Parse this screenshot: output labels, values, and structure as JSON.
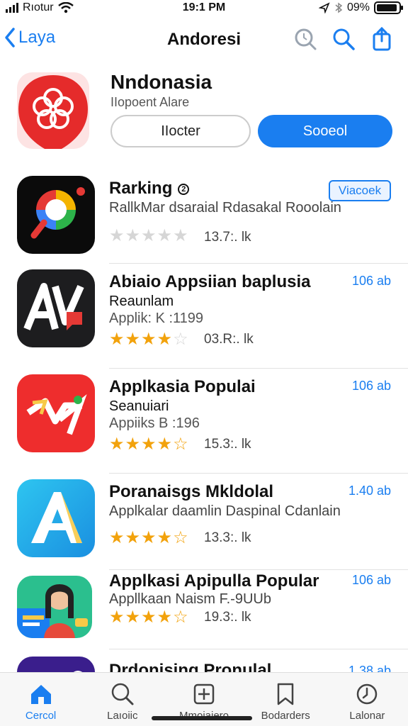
{
  "status_bar": {
    "carrier": "Rıotur",
    "time": "19:1 PM",
    "battery": "09%"
  },
  "nav": {
    "back_label": "Laya",
    "title": "Andoresi"
  },
  "featured": {
    "title": "Nndonasia",
    "subtitle": "IIopoent Alare",
    "secondary_button": "IIocter",
    "primary_button": "Sooeol"
  },
  "apps": [
    {
      "title": "Rarking",
      "line2": "RallkMar dsaraial Rdasakal Rooolain",
      "line3": "",
      "rating": 0,
      "count": "13.7:. lk",
      "size": "",
      "get_label": "Viacoek"
    },
    {
      "title": "Abiaio Appsiian baplusia",
      "line2": "Reaunlam",
      "line3": "Applik: K :1199",
      "rating": 4.5,
      "count": "03.R:. lk",
      "size": "106 ab"
    },
    {
      "title": "Applkasia Populai",
      "line2": "Seanuiari",
      "line3": "Appiiks B :196",
      "rating": 4.5,
      "count": "15.3:. lk",
      "size": "106 ab"
    },
    {
      "title": "Poranaisgs Mkldolal",
      "line2": "Applkalar daamlin Daspinal Cdanlain",
      "line3": "",
      "rating": 4.5,
      "count": "13.3:. lk",
      "size": "1.40 ab"
    },
    {
      "title": "Applkasi Apipulla Popular",
      "line2": "Appllkaan Naism     F.-9UUb",
      "line3": "",
      "rating": 4.5,
      "count": "19.3:. lk",
      "size": "106 ab"
    },
    {
      "title": "Drdonising Pronulal",
      "line2": "",
      "line3": "",
      "rating": 0,
      "count": "",
      "size": "1.38 ab"
    }
  ],
  "tabs": [
    {
      "label": "Cercol",
      "icon": "home-icon",
      "active": true
    },
    {
      "label": "Laıoiic",
      "icon": "search-icon",
      "active": false
    },
    {
      "label": "Mmoiaiero",
      "icon": "add-square-icon",
      "active": false
    },
    {
      "label": "Bodarders",
      "icon": "bookmark-icon",
      "active": false
    },
    {
      "label": "Lalonar",
      "icon": "clock-icon",
      "active": false
    }
  ],
  "colors": {
    "accent": "#1a7ef0",
    "star": "#f2a20c"
  }
}
